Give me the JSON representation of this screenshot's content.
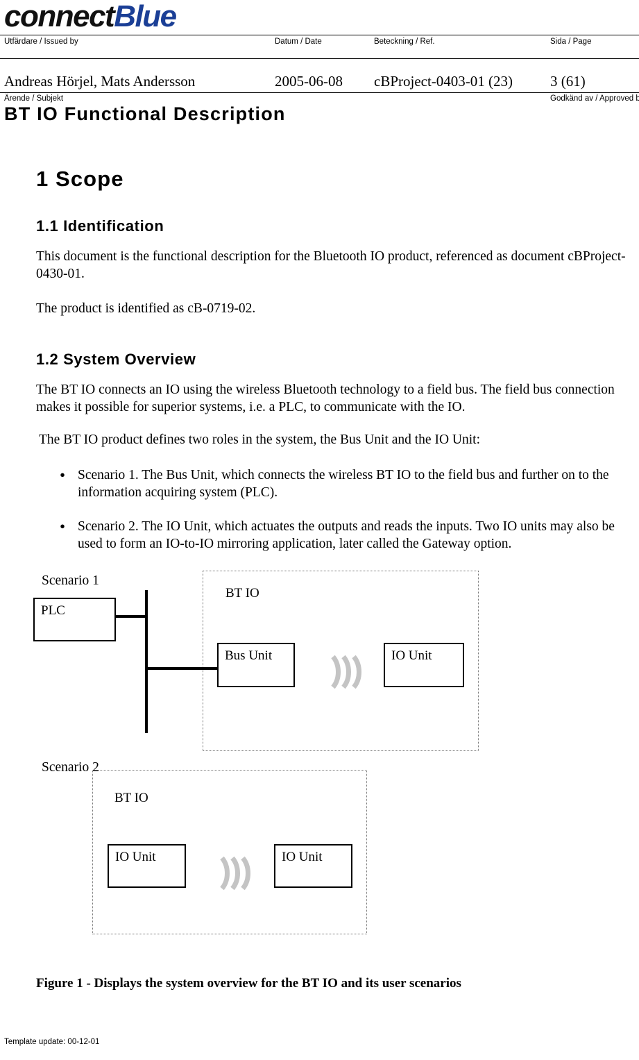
{
  "header": {
    "logo": {
      "part1": "connect",
      "part2": "Blue",
      "blue_hex": "#1b3f96"
    },
    "labels": {
      "issued_by": "Utfärdare / Issued by",
      "date": "Datum / Date",
      "ref": "Beteckning / Ref.",
      "page": "Sida / Page",
      "subject": "Ärende / Subjekt",
      "approved_by": "Godkänd av / Approved by"
    },
    "values": {
      "issued_by": "Andreas Hörjel, Mats Andersson",
      "date": "2005-06-08",
      "ref": "cBProject-0403-01 (23)",
      "page": "3 (61)"
    },
    "document_title": "BT IO Functional Description"
  },
  "body": {
    "h1_scope": "1  Scope",
    "h2_identification": "1.1 Identification",
    "p_identification_1": "This document is the functional description for the Bluetooth IO product, referenced as document cBProject-0430-01.",
    "p_identification_2": "The product is identified as cB-0719-02.",
    "h2_system_overview": "1.2 System Overview",
    "p_system_1": "The BT IO connects an IO using the wireless Bluetooth technology to a field bus. The field bus connection makes it possible for superior systems, i.e. a PLC, to communicate with the IO.",
    "p_system_2": "The BT IO product defines two roles in the system, the Bus Unit and the IO Unit:",
    "bullet_marker": "•",
    "bullets": [
      "Scenario 1. The Bus Unit, which connects the wireless BT IO to the field bus and further on to the information acquiring system (PLC).",
      "Scenario 2. The IO Unit, which actuates the outputs and reads the inputs. Two IO units may also be used to form an IO-to-IO mirroring application, later called the Gateway option."
    ]
  },
  "figure": {
    "scenario1_label": "Scenario 1",
    "scenario2_label": "Scenario 2",
    "btio_label_1": "BT IO",
    "btio_label_2": "BT IO",
    "plc_label": "PLC",
    "bus_unit_label": "Bus Unit",
    "io_unit_label_1": "IO Unit",
    "io_unit_label_2": "IO Unit",
    "io_unit_label_3": "IO Unit",
    "wave_icon_color": "#c4c4c4",
    "caption": "Figure 1 - Displays the system overview for the BT IO and its user scenarios"
  },
  "footer": {
    "template_update": "Template update: 00-12-01"
  }
}
